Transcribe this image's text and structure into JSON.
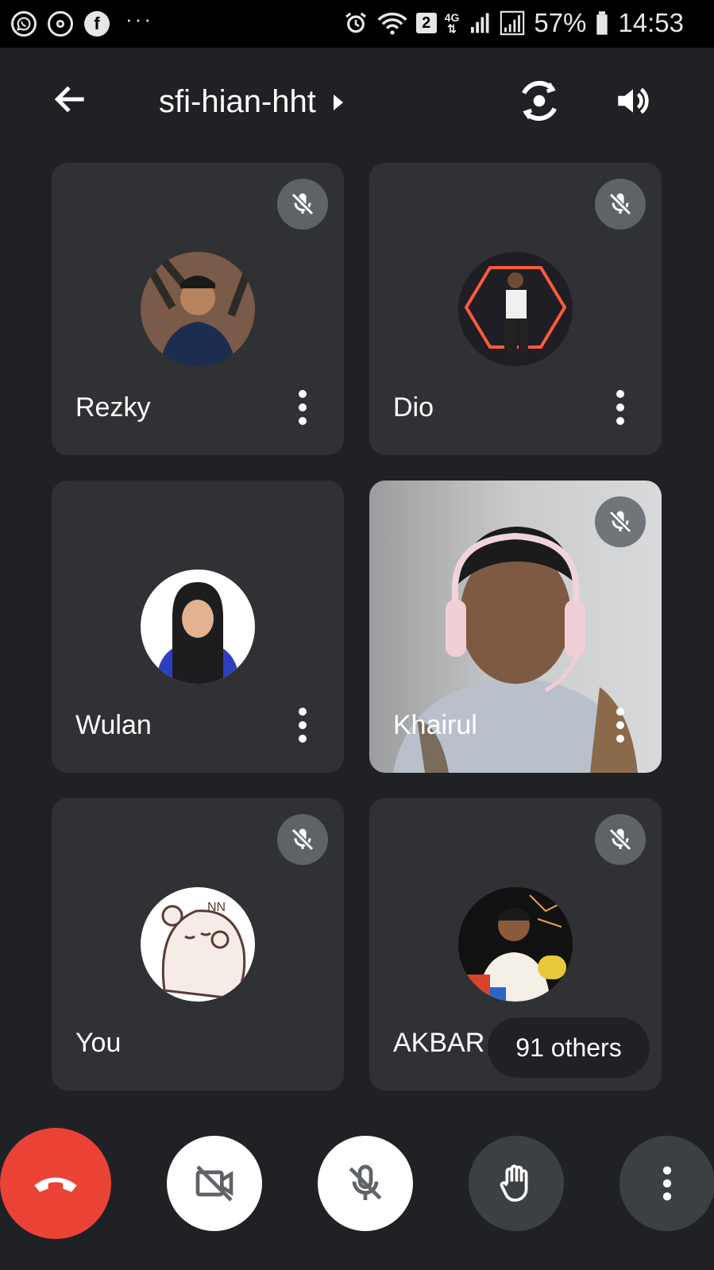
{
  "status_bar": {
    "apps": [
      "whatsapp-icon",
      "chrome-icon",
      "facebook-icon"
    ],
    "more": "···",
    "sim_badge": "2",
    "network": "4G",
    "battery": "57%",
    "time": "14:53"
  },
  "header": {
    "meeting_code": "sfi-hian-hht"
  },
  "tiles": [
    {
      "name": "Rezky",
      "muted": true,
      "avatar_bg": "#7a5a48",
      "shirt": "#1c2d50"
    },
    {
      "name": "Dio",
      "muted": true,
      "avatar_bg": "#1e1e24",
      "shirt": "#f0f0f0"
    },
    {
      "name": "Wulan",
      "muted": false,
      "avatar_bg": "#ffffff",
      "shirt": "#2d3fbf"
    },
    {
      "name": "Khairul",
      "muted": true,
      "avatar_bg": "#bfc3c7",
      "shirt": "#b9c0cc"
    },
    {
      "name": "You",
      "muted": true,
      "avatar_bg": "#ffffff",
      "shirt": "#f5ece6"
    },
    {
      "name": "AKBAR",
      "muted": true,
      "avatar_bg": "#111111",
      "shirt": "#f4f0e8"
    }
  ],
  "others_pill": "91 others",
  "colors": {
    "background": "#202124",
    "tile": "#303134",
    "end_call": "#ea4335",
    "control_dark": "#3c4043"
  }
}
